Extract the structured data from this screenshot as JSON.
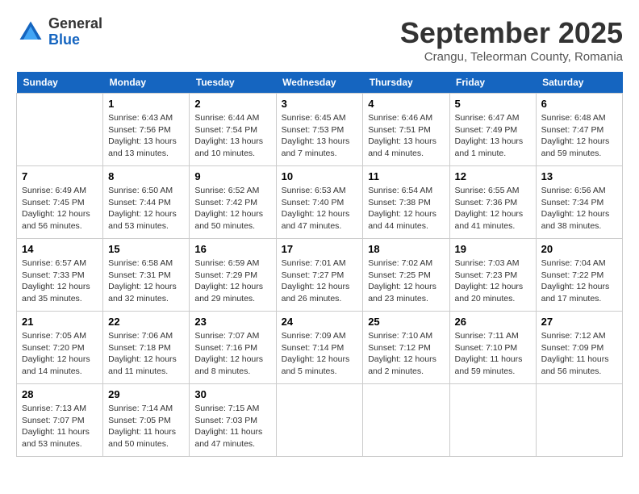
{
  "header": {
    "logo_line1": "General",
    "logo_line2": "Blue",
    "month": "September 2025",
    "location": "Crangu, Teleorman County, Romania"
  },
  "weekdays": [
    "Sunday",
    "Monday",
    "Tuesday",
    "Wednesday",
    "Thursday",
    "Friday",
    "Saturday"
  ],
  "weeks": [
    [
      {
        "day": "",
        "info": ""
      },
      {
        "day": "1",
        "info": "Sunrise: 6:43 AM\nSunset: 7:56 PM\nDaylight: 13 hours\nand 13 minutes."
      },
      {
        "day": "2",
        "info": "Sunrise: 6:44 AM\nSunset: 7:54 PM\nDaylight: 13 hours\nand 10 minutes."
      },
      {
        "day": "3",
        "info": "Sunrise: 6:45 AM\nSunset: 7:53 PM\nDaylight: 13 hours\nand 7 minutes."
      },
      {
        "day": "4",
        "info": "Sunrise: 6:46 AM\nSunset: 7:51 PM\nDaylight: 13 hours\nand 4 minutes."
      },
      {
        "day": "5",
        "info": "Sunrise: 6:47 AM\nSunset: 7:49 PM\nDaylight: 13 hours\nand 1 minute."
      },
      {
        "day": "6",
        "info": "Sunrise: 6:48 AM\nSunset: 7:47 PM\nDaylight: 12 hours\nand 59 minutes."
      }
    ],
    [
      {
        "day": "7",
        "info": "Sunrise: 6:49 AM\nSunset: 7:45 PM\nDaylight: 12 hours\nand 56 minutes."
      },
      {
        "day": "8",
        "info": "Sunrise: 6:50 AM\nSunset: 7:44 PM\nDaylight: 12 hours\nand 53 minutes."
      },
      {
        "day": "9",
        "info": "Sunrise: 6:52 AM\nSunset: 7:42 PM\nDaylight: 12 hours\nand 50 minutes."
      },
      {
        "day": "10",
        "info": "Sunrise: 6:53 AM\nSunset: 7:40 PM\nDaylight: 12 hours\nand 47 minutes."
      },
      {
        "day": "11",
        "info": "Sunrise: 6:54 AM\nSunset: 7:38 PM\nDaylight: 12 hours\nand 44 minutes."
      },
      {
        "day": "12",
        "info": "Sunrise: 6:55 AM\nSunset: 7:36 PM\nDaylight: 12 hours\nand 41 minutes."
      },
      {
        "day": "13",
        "info": "Sunrise: 6:56 AM\nSunset: 7:34 PM\nDaylight: 12 hours\nand 38 minutes."
      }
    ],
    [
      {
        "day": "14",
        "info": "Sunrise: 6:57 AM\nSunset: 7:33 PM\nDaylight: 12 hours\nand 35 minutes."
      },
      {
        "day": "15",
        "info": "Sunrise: 6:58 AM\nSunset: 7:31 PM\nDaylight: 12 hours\nand 32 minutes."
      },
      {
        "day": "16",
        "info": "Sunrise: 6:59 AM\nSunset: 7:29 PM\nDaylight: 12 hours\nand 29 minutes."
      },
      {
        "day": "17",
        "info": "Sunrise: 7:01 AM\nSunset: 7:27 PM\nDaylight: 12 hours\nand 26 minutes."
      },
      {
        "day": "18",
        "info": "Sunrise: 7:02 AM\nSunset: 7:25 PM\nDaylight: 12 hours\nand 23 minutes."
      },
      {
        "day": "19",
        "info": "Sunrise: 7:03 AM\nSunset: 7:23 PM\nDaylight: 12 hours\nand 20 minutes."
      },
      {
        "day": "20",
        "info": "Sunrise: 7:04 AM\nSunset: 7:22 PM\nDaylight: 12 hours\nand 17 minutes."
      }
    ],
    [
      {
        "day": "21",
        "info": "Sunrise: 7:05 AM\nSunset: 7:20 PM\nDaylight: 12 hours\nand 14 minutes."
      },
      {
        "day": "22",
        "info": "Sunrise: 7:06 AM\nSunset: 7:18 PM\nDaylight: 12 hours\nand 11 minutes."
      },
      {
        "day": "23",
        "info": "Sunrise: 7:07 AM\nSunset: 7:16 PM\nDaylight: 12 hours\nand 8 minutes."
      },
      {
        "day": "24",
        "info": "Sunrise: 7:09 AM\nSunset: 7:14 PM\nDaylight: 12 hours\nand 5 minutes."
      },
      {
        "day": "25",
        "info": "Sunrise: 7:10 AM\nSunset: 7:12 PM\nDaylight: 12 hours\nand 2 minutes."
      },
      {
        "day": "26",
        "info": "Sunrise: 7:11 AM\nSunset: 7:10 PM\nDaylight: 11 hours\nand 59 minutes."
      },
      {
        "day": "27",
        "info": "Sunrise: 7:12 AM\nSunset: 7:09 PM\nDaylight: 11 hours\nand 56 minutes."
      }
    ],
    [
      {
        "day": "28",
        "info": "Sunrise: 7:13 AM\nSunset: 7:07 PM\nDaylight: 11 hours\nand 53 minutes."
      },
      {
        "day": "29",
        "info": "Sunrise: 7:14 AM\nSunset: 7:05 PM\nDaylight: 11 hours\nand 50 minutes."
      },
      {
        "day": "30",
        "info": "Sunrise: 7:15 AM\nSunset: 7:03 PM\nDaylight: 11 hours\nand 47 minutes."
      },
      {
        "day": "",
        "info": ""
      },
      {
        "day": "",
        "info": ""
      },
      {
        "day": "",
        "info": ""
      },
      {
        "day": "",
        "info": ""
      }
    ]
  ]
}
